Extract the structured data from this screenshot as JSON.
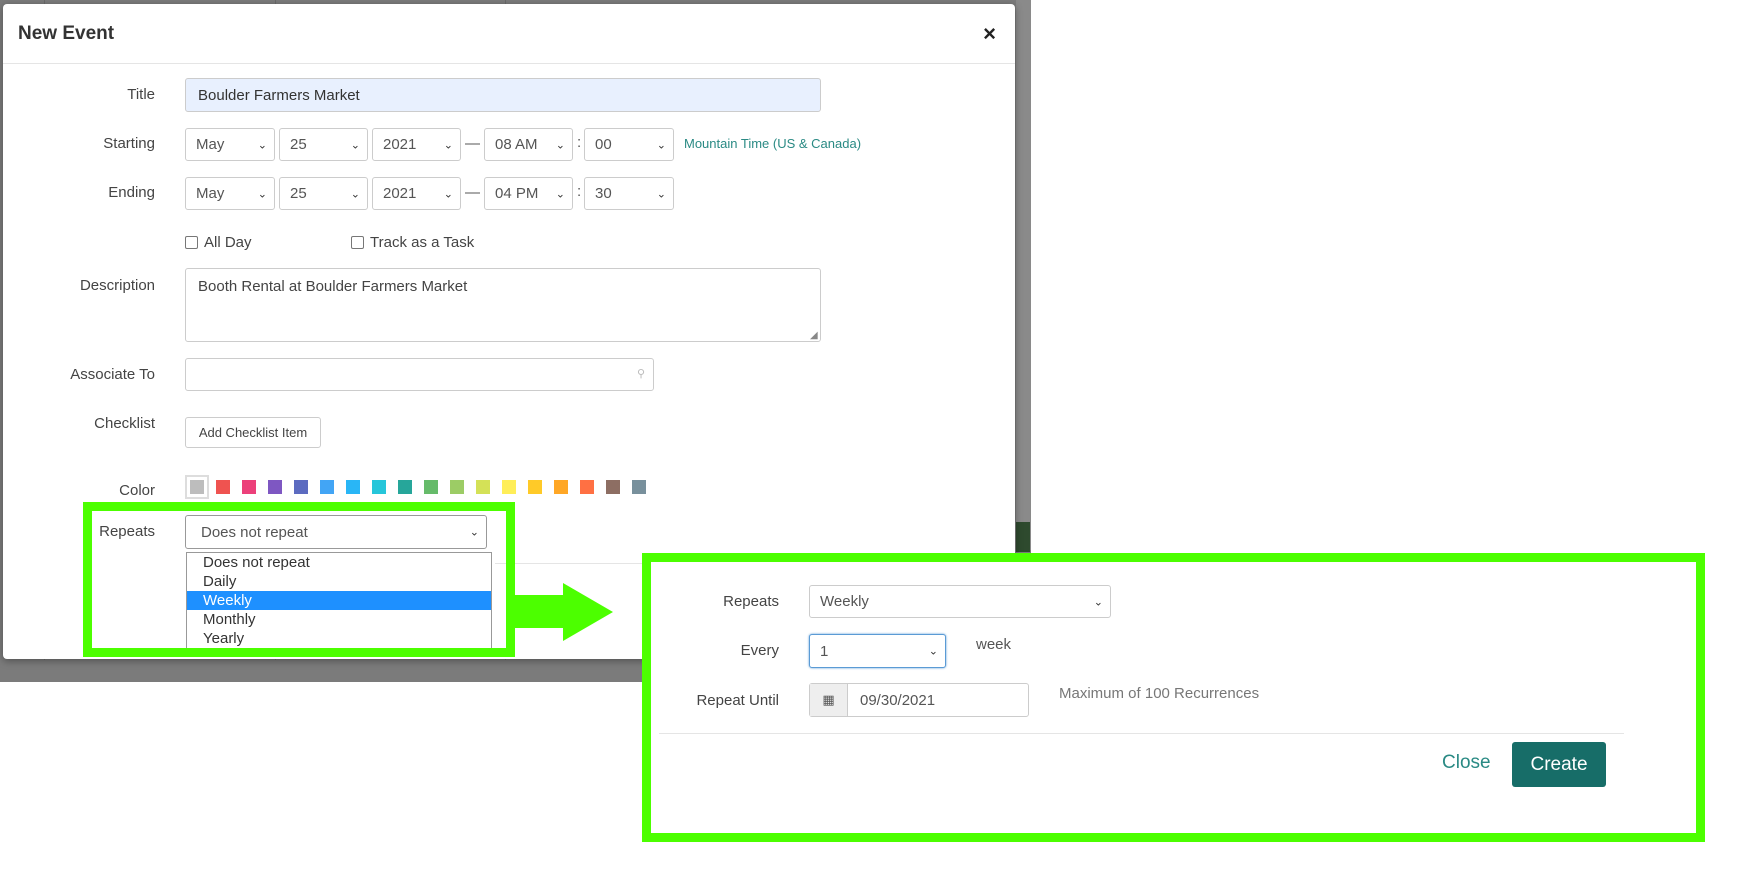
{
  "modal": {
    "title": "New Event",
    "close_symbol": "×"
  },
  "form": {
    "title_label": "Title",
    "title_value": "Boulder Farmers Market",
    "starting_label": "Starting",
    "starting": {
      "month": "May",
      "day": "25",
      "year": "2021",
      "hour": "08 AM",
      "minute": "00"
    },
    "ending_label": "Ending",
    "ending": {
      "month": "May",
      "day": "25",
      "year": "2021",
      "hour": "04 PM",
      "minute": "30"
    },
    "timezone": "Mountain Time (US & Canada)",
    "separator_dash": "—",
    "separator_colon": ":",
    "all_day_label": "All Day",
    "track_task_label": "Track as a Task",
    "description_label": "Description",
    "description_value": "Booth Rental  at Boulder Farmers Market",
    "associate_label": "Associate To",
    "checklist_label": "Checklist",
    "add_checklist_label": "Add Checklist Item",
    "color_label": "Color",
    "colors": [
      "#bdbdbd",
      "#ef5350",
      "#ec407a",
      "#7e57c2",
      "#5c6bc0",
      "#42a5f5",
      "#29b6f6",
      "#26c6da",
      "#26a69a",
      "#66bb6a",
      "#9ccc65",
      "#d4e157",
      "#ffee58",
      "#ffca28",
      "#ffa726",
      "#ff7043",
      "#8d6e63",
      "#78909c"
    ],
    "repeats_label": "Repeats",
    "repeats_value": "Does not repeat",
    "repeat_options": [
      "Does not repeat",
      "Daily",
      "Weekly",
      "Monthly",
      "Yearly"
    ],
    "selected_option": "Weekly"
  },
  "zoom": {
    "repeats_label": "Repeats",
    "repeats_value": "Weekly",
    "every_label": "Every",
    "every_value": "1",
    "every_unit": "week",
    "until_label": "Repeat Until",
    "until_value": "09/30/2021",
    "max_note": "Maximum of 100 Recurrences",
    "close_label": "Close",
    "create_label": "Create"
  },
  "highlight_color": "#4cff00",
  "accent_color": "#176d68"
}
